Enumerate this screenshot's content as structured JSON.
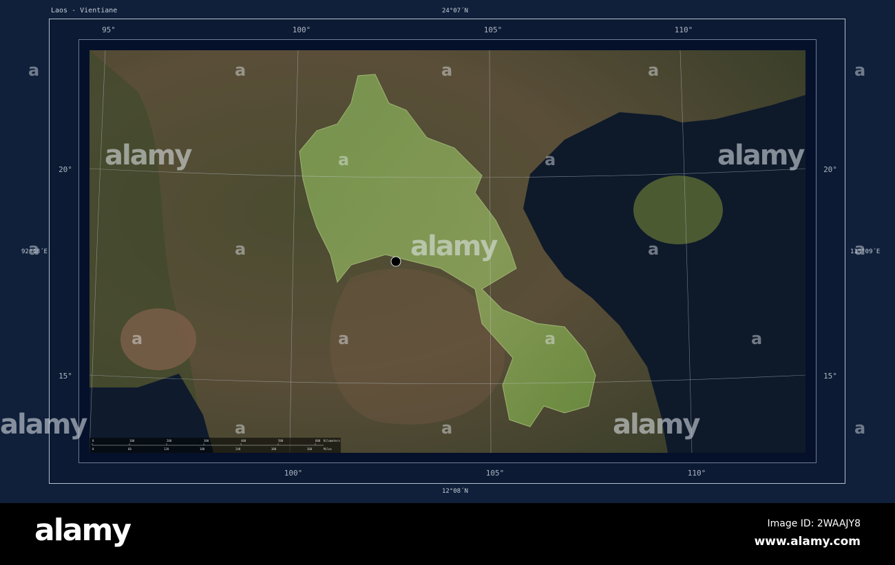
{
  "title": "Laos - Vientiane",
  "coords": {
    "top": "24°07´N",
    "bottom": "12°08´N",
    "left": "92°48´E",
    "right": "113°09´E"
  },
  "longitudes_top": [
    "95°",
    "100°",
    "105°",
    "110°"
  ],
  "longitudes_bottom": [
    "100°",
    "105°",
    "110°"
  ],
  "latitudes": [
    "20°",
    "15°"
  ],
  "marker": {
    "name": "Vientiane",
    "color": "#000000"
  },
  "scalebar": {
    "km_ticks": [
      "0",
      "100",
      "200",
      "300",
      "400",
      "500",
      "600"
    ],
    "km_unit": "Kilometers",
    "mi_ticks": [
      "0",
      "60",
      "120",
      "180",
      "240",
      "300",
      "360"
    ],
    "mi_unit": "Miles"
  },
  "watermark": "alamy",
  "watermark_glyph": "a",
  "footer": {
    "logo": "alamy",
    "image_id": "Image ID: 2WAAJY8",
    "url": "www.alamy.com"
  },
  "colors": {
    "frame_bg": "#10203a",
    "land": "#4e5034",
    "sea": "#0e1a2a",
    "highlight": "#7c9a4c"
  }
}
